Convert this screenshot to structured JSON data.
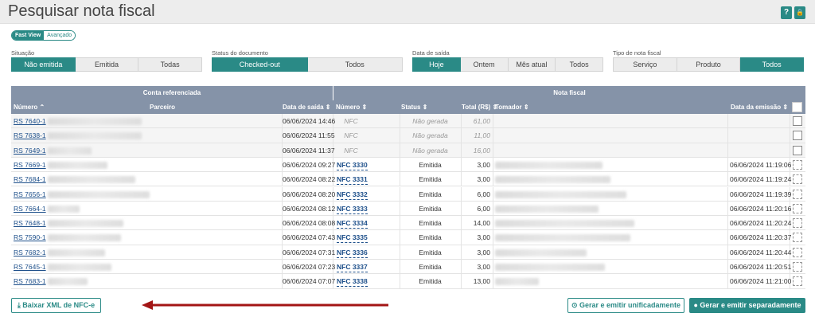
{
  "header": {
    "title": "Pesquisar nota fiscal",
    "help_label": "?",
    "lock_label": "🔒"
  },
  "view_toggle": {
    "fast": "Fast View",
    "advanced": "Avançado"
  },
  "filters": {
    "situacao": {
      "label": "Situação",
      "options": [
        "Não emitida",
        "Emitida",
        "Todas"
      ],
      "selected": 0
    },
    "status": {
      "label": "Status do documento",
      "options": [
        "Checked-out",
        "Todos"
      ],
      "selected": 0
    },
    "data": {
      "label": "Data de saída",
      "options": [
        "Hoje",
        "Ontem",
        "Mês atual",
        "Todos"
      ],
      "selected": 0
    },
    "tipo": {
      "label": "Tipo de nota fiscal",
      "options": [
        "Serviço",
        "Produto",
        "Todos"
      ],
      "selected": 2
    }
  },
  "table": {
    "group_left": "Conta referenciada",
    "group_right": "Nota fiscal",
    "columns": {
      "numero": "Número ⌃",
      "parceiro": "Parceiro",
      "data_saida": "Data de saída ⇕",
      "nf_numero": "Número ⇕",
      "status": "Status ⇕",
      "total": "Total (R$) ⇕",
      "tomador": "Tomador ⇕",
      "data_emissao": "Data da emissão ⇕"
    },
    "rows": [
      {
        "conta": "RS 7640-1",
        "saida": "06/06/2024 14:46",
        "nf": "NFC",
        "status": "Não gerada",
        "total": "61,00",
        "emissao": "",
        "pw": 118,
        "tw": 0,
        "gerada": false
      },
      {
        "conta": "RS 7638-1",
        "saida": "06/06/2024 11:55",
        "nf": "NFC",
        "status": "Não gerada",
        "total": "11,00",
        "emissao": "",
        "pw": 118,
        "tw": 0,
        "gerada": false
      },
      {
        "conta": "RS 7649-1",
        "saida": "06/06/2024 11:37",
        "nf": "NFC",
        "status": "Não gerada",
        "total": "16,00",
        "emissao": "",
        "pw": 55,
        "tw": 0,
        "gerada": false
      },
      {
        "conta": "RS 7669-1",
        "saida": "06/06/2024 09:27",
        "nf": "NFC 3330",
        "status": "Emitida",
        "total": "3,00",
        "emissao": "06/06/2024 11:19:06",
        "pw": 75,
        "tw": 135,
        "gerada": true
      },
      {
        "conta": "RS 7684-1",
        "saida": "06/06/2024 08:22",
        "nf": "NFC 3331",
        "status": "Emitida",
        "total": "3,00",
        "emissao": "06/06/2024 11:19:24",
        "pw": 110,
        "tw": 145,
        "gerada": true
      },
      {
        "conta": "RS 7656-1",
        "saida": "06/06/2024 08:20",
        "nf": "NFC 3332",
        "status": "Emitida",
        "total": "6,00",
        "emissao": "06/06/2024 11:19:39",
        "pw": 128,
        "tw": 165,
        "gerada": true
      },
      {
        "conta": "RS 7664-1",
        "saida": "06/06/2024 08:12",
        "nf": "NFC 3333",
        "status": "Emitida",
        "total": "6,00",
        "emissao": "06/06/2024 11:20:16",
        "pw": 40,
        "tw": 130,
        "gerada": true
      },
      {
        "conta": "RS 7648-1",
        "saida": "06/06/2024 08:08",
        "nf": "NFC 3334",
        "status": "Emitida",
        "total": "14,00",
        "emissao": "06/06/2024 11:20:24",
        "pw": 95,
        "tw": 175,
        "gerada": true
      },
      {
        "conta": "RS 7590-1",
        "saida": "06/06/2024 07:43",
        "nf": "NFC 3335",
        "status": "Emitida",
        "total": "3,00",
        "emissao": "06/06/2024 11:20:37",
        "pw": 92,
        "tw": 170,
        "gerada": true
      },
      {
        "conta": "RS 7682-1",
        "saida": "06/06/2024 07:31",
        "nf": "NFC 3336",
        "status": "Emitida",
        "total": "3,00",
        "emissao": "06/06/2024 11:20:44",
        "pw": 72,
        "tw": 115,
        "gerada": true
      },
      {
        "conta": "RS 7645-1",
        "saida": "06/06/2024 07:23",
        "nf": "NFC 3337",
        "status": "Emitida",
        "total": "3,00",
        "emissao": "06/06/2024 11:20:51",
        "pw": 80,
        "tw": 138,
        "gerada": true
      },
      {
        "conta": "RS 7683-1",
        "saida": "06/06/2024 07:07",
        "nf": "NFC 3338",
        "status": "Emitida",
        "total": "13,00",
        "emissao": "06/06/2024 11:21:00",
        "pw": 50,
        "tw": 55,
        "gerada": true
      }
    ]
  },
  "actions": {
    "download_xml": "⤓ Baixar XML de NFC-e",
    "emit_unified": "⊙ Gerar e emitir unificadamente",
    "emit_separate": "● Gerar e emitir separadamente"
  },
  "colors": {
    "accent": "#2a8a86",
    "table_header": "#8593a8",
    "link": "#1d4f8a",
    "arrow": "#a31515"
  }
}
